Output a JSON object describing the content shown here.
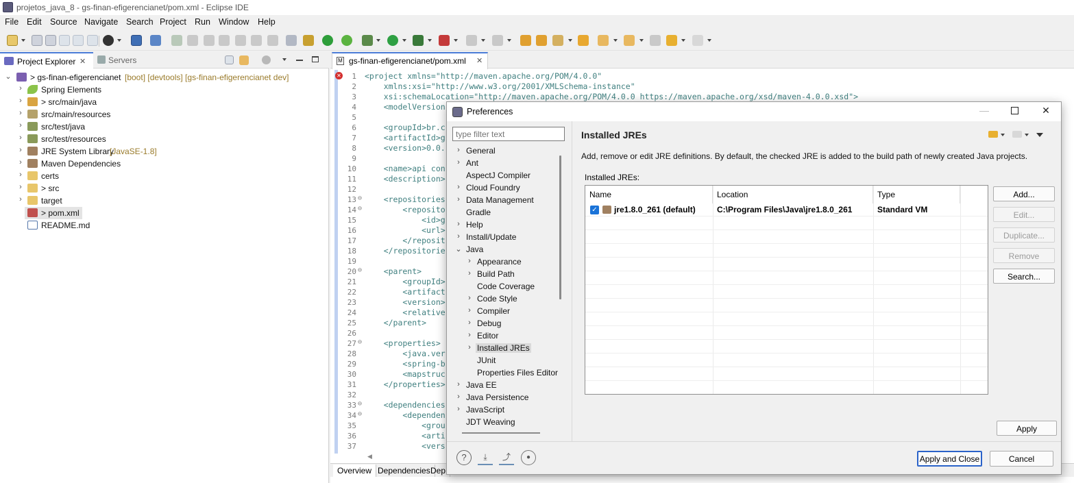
{
  "window": {
    "title": "projetos_java_8 - gs-finan-efigerencianet/pom.xml - Eclipse IDE"
  },
  "menu": [
    "File",
    "Edit",
    "Source",
    "Navigate",
    "Search",
    "Project",
    "Run",
    "Window",
    "Help"
  ],
  "left_panel": {
    "tabs": [
      {
        "label": "Project Explorer",
        "active": true
      },
      {
        "label": "Servers",
        "active": false
      }
    ],
    "tree": [
      {
        "label": "> gs-finan-efigerencianet",
        "decoration": "[boot] [devtools] [gs-finan-efigerencianet dev]",
        "icon": "maven-project-icon",
        "expanded": true
      },
      {
        "label": "Spring Elements",
        "decoration": "",
        "icon": "spring-leaf-icon"
      },
      {
        "label": "> src/main/java",
        "decoration": "",
        "icon": "source-folder-icon"
      },
      {
        "label": "src/main/resources",
        "decoration": "",
        "icon": "source-folder-icon"
      },
      {
        "label": "src/test/java",
        "decoration": "",
        "icon": "source-folder-icon"
      },
      {
        "label": "src/test/resources",
        "decoration": "",
        "icon": "source-folder-icon"
      },
      {
        "label": "JRE System Library",
        "decoration": "[JavaSE-1.8]",
        "icon": "library-icon"
      },
      {
        "label": "Maven Dependencies",
        "decoration": "",
        "icon": "library-icon"
      },
      {
        "label": "certs",
        "decoration": "",
        "icon": "folder-icon"
      },
      {
        "label": "> src",
        "decoration": "",
        "icon": "folder-icon"
      },
      {
        "label": "target",
        "decoration": "",
        "icon": "folder-icon"
      },
      {
        "label": "> pom.xml",
        "decoration": "",
        "icon": "xml-file-icon",
        "selected": true
      },
      {
        "label": "README.md",
        "decoration": "",
        "icon": "markdown-file-icon"
      }
    ]
  },
  "editor": {
    "tab_label": "gs-finan-efigerencianet/pom.xml",
    "lines": [
      {
        "n": "1",
        "fold": "",
        "t": "<project xmlns=\"http://maven.apache.org/POM/4.0.0\""
      },
      {
        "n": "2",
        "fold": "",
        "t": "    xmlns:xsi=\"http://www.w3.org/2001/XMLSchema-instance\""
      },
      {
        "n": "3",
        "fold": "",
        "t": "    xsi:schemaLocation=\"http://maven.apache.org/POM/4.0.0 https://maven.apache.org/xsd/maven-4.0.0.xsd\">"
      },
      {
        "n": "4",
        "fold": "",
        "t": "    <modelVersion"
      },
      {
        "n": "5",
        "fold": "",
        "t": ""
      },
      {
        "n": "6",
        "fold": "",
        "t": "    <groupId>br.c"
      },
      {
        "n": "7",
        "fold": "",
        "t": "    <artifactId>g"
      },
      {
        "n": "8",
        "fold": "",
        "t": "    <version>0.0."
      },
      {
        "n": "9",
        "fold": "",
        "t": ""
      },
      {
        "n": "10",
        "fold": "",
        "t": "    <name>api con"
      },
      {
        "n": "11",
        "fold": "",
        "t": "    <description>"
      },
      {
        "n": "12",
        "fold": "",
        "t": ""
      },
      {
        "n": "13",
        "fold": "⊖",
        "t": "    <repositories"
      },
      {
        "n": "14",
        "fold": "⊖",
        "t": "        <reposito"
      },
      {
        "n": "15",
        "fold": "",
        "t": "            <id>g"
      },
      {
        "n": "16",
        "fold": "",
        "t": "            <url>"
      },
      {
        "n": "17",
        "fold": "",
        "t": "        </reposit"
      },
      {
        "n": "18",
        "fold": "",
        "t": "    </repositorie"
      },
      {
        "n": "19",
        "fold": "",
        "t": ""
      },
      {
        "n": "20",
        "fold": "⊖",
        "t": "    <parent>"
      },
      {
        "n": "21",
        "fold": "",
        "t": "        <groupId>"
      },
      {
        "n": "22",
        "fold": "",
        "t": "        <artifact"
      },
      {
        "n": "23",
        "fold": "",
        "t": "        <version>"
      },
      {
        "n": "24",
        "fold": "",
        "t": "        <relative"
      },
      {
        "n": "25",
        "fold": "",
        "t": "    </parent>"
      },
      {
        "n": "26",
        "fold": "",
        "t": ""
      },
      {
        "n": "27",
        "fold": "⊖",
        "t": "    <properties>"
      },
      {
        "n": "28",
        "fold": "",
        "t": "        <java.ver"
      },
      {
        "n": "29",
        "fold": "",
        "t": "        <spring-b"
      },
      {
        "n": "30",
        "fold": "",
        "t": "        <mapstruc"
      },
      {
        "n": "31",
        "fold": "",
        "t": "    </properties>"
      },
      {
        "n": "32",
        "fold": "",
        "t": ""
      },
      {
        "n": "33",
        "fold": "⊖",
        "t": "    <dependencies"
      },
      {
        "n": "34",
        "fold": "⊖",
        "t": "        <dependen"
      },
      {
        "n": "35",
        "fold": "",
        "t": "            <grou"
      },
      {
        "n": "36",
        "fold": "",
        "t": "            <arti"
      },
      {
        "n": "37",
        "fold": "",
        "t": "            <vers"
      }
    ],
    "bottom_tabs": [
      "Overview",
      "Dependencies",
      "Dep"
    ]
  },
  "dialog": {
    "title": "Preferences",
    "filter_placeholder": "type filter text",
    "nav": [
      {
        "label": "General",
        "level": 0,
        "chevron": ">"
      },
      {
        "label": "Ant",
        "level": 0,
        "chevron": ">"
      },
      {
        "label": "AspectJ Compiler",
        "level": 0,
        "chevron": ""
      },
      {
        "label": "Cloud Foundry",
        "level": 0,
        "chevron": ">"
      },
      {
        "label": "Data Management",
        "level": 0,
        "chevron": ">"
      },
      {
        "label": "Gradle",
        "level": 0,
        "chevron": ""
      },
      {
        "label": "Help",
        "level": 0,
        "chevron": ">"
      },
      {
        "label": "Install/Update",
        "level": 0,
        "chevron": ">"
      },
      {
        "label": "Java",
        "level": 0,
        "chevron": "v"
      },
      {
        "label": "Appearance",
        "level": 1,
        "chevron": ">"
      },
      {
        "label": "Build Path",
        "level": 1,
        "chevron": ">"
      },
      {
        "label": "Code Coverage",
        "level": 1,
        "chevron": ""
      },
      {
        "label": "Code Style",
        "level": 1,
        "chevron": ">"
      },
      {
        "label": "Compiler",
        "level": 1,
        "chevron": ">"
      },
      {
        "label": "Debug",
        "level": 1,
        "chevron": ">"
      },
      {
        "label": "Editor",
        "level": 1,
        "chevron": ">"
      },
      {
        "label": "Installed JREs",
        "level": 1,
        "chevron": ">",
        "selected": true
      },
      {
        "label": "JUnit",
        "level": 1,
        "chevron": ""
      },
      {
        "label": "Properties Files Editor",
        "level": 1,
        "chevron": ""
      },
      {
        "label": "Java EE",
        "level": 0,
        "chevron": ">"
      },
      {
        "label": "Java Persistence",
        "level": 0,
        "chevron": ">"
      },
      {
        "label": "JavaScript",
        "level": 0,
        "chevron": ">"
      },
      {
        "label": "JDT Weaving",
        "level": 0,
        "chevron": ""
      }
    ],
    "page": {
      "title": "Installed JREs",
      "description": "Add, remove or edit JRE definitions. By default, the checked JRE is added to the build path of newly created Java projects.",
      "table_label": "Installed JREs:",
      "columns": [
        "Name",
        "Location",
        "Type"
      ],
      "rows": [
        {
          "name": "jre1.8.0_261 (default)",
          "location": "C:\\Program Files\\Java\\jre1.8.0_261",
          "type": "Standard VM",
          "checked": true
        }
      ],
      "buttons": [
        {
          "label": "Add...",
          "enabled": true
        },
        {
          "label": "Edit...",
          "enabled": false
        },
        {
          "label": "Duplicate...",
          "enabled": false
        },
        {
          "label": "Remove",
          "enabled": false
        },
        {
          "label": "Search...",
          "enabled": true
        }
      ],
      "apply_label": "Apply"
    },
    "footer": {
      "apply_close_label": "Apply and Close",
      "cancel_label": "Cancel"
    }
  }
}
